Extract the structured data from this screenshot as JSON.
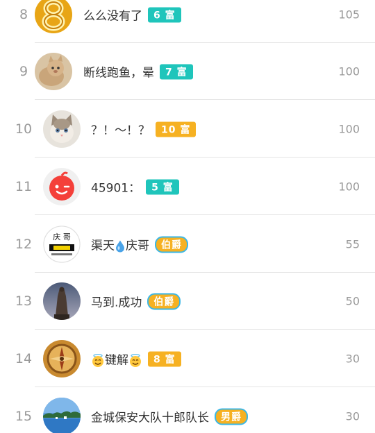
{
  "colors": {
    "rich_badge_cyan": "#1fc5bb",
    "rich_badge_orange": "#f6b122",
    "noble_badge": "#f6b122",
    "rank_text": "#9a9a9a",
    "name_text": "#333333"
  },
  "rows": [
    {
      "rank": "8",
      "name": "么么没有了",
      "badge": "6 富",
      "badge_type": "rich-cyan",
      "score": "105",
      "avatar_icon": "gold-8-icon"
    },
    {
      "rank": "9",
      "name": "断线跑鱼，晕",
      "badge": "7 富",
      "badge_type": "rich-cyan",
      "score": "100",
      "avatar_icon": "cat-icon"
    },
    {
      "rank": "10",
      "name": "？！～！？",
      "badge": "10 富",
      "badge_type": "rich-orange",
      "score": "100",
      "avatar_icon": "kitten-icon"
    },
    {
      "rank": "11",
      "name": "45901：",
      "badge": "5 富",
      "badge_type": "rich-cyan",
      "score": "100",
      "avatar_icon": "red-face-icon"
    },
    {
      "rank": "12",
      "name_a": "渠天",
      "name_b": "庆哥",
      "name": "渠天💧庆哥",
      "badge": "伯爵",
      "badge_type": "noble",
      "score": "55",
      "avatar_icon": "qingge-logo-icon",
      "avatar_text_top": "庆 哥"
    },
    {
      "rank": "13",
      "name": "马到.成功",
      "badge": "伯爵",
      "badge_type": "noble",
      "score": "50",
      "avatar_icon": "statue-icon"
    },
    {
      "rank": "14",
      "name": "键解",
      "badge": "8 富",
      "badge_type": "rich-orange",
      "score": "30",
      "avatar_icon": "compass-icon"
    },
    {
      "rank": "15",
      "name": "金城保安大队十郎队长",
      "badge": "男爵",
      "badge_type": "noble",
      "score": "30",
      "avatar_icon": "lake-icon"
    }
  ]
}
